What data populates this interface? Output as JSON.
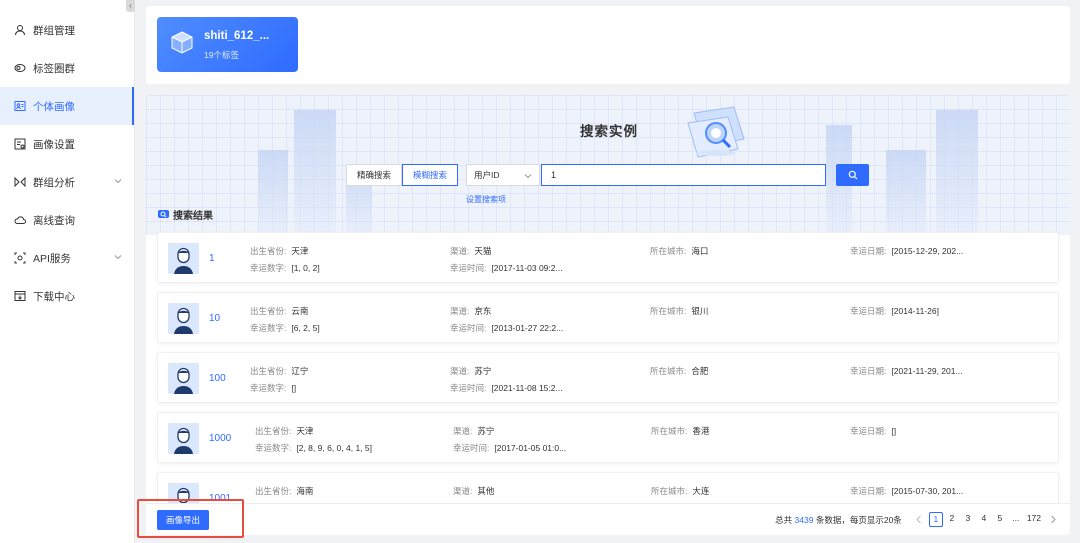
{
  "sidebar": {
    "collapse_glyph": "‹",
    "items": [
      {
        "label": "群组管理",
        "icon": "group-icon"
      },
      {
        "label": "标签圈群",
        "icon": "tag-circle-icon"
      },
      {
        "label": "个体画像",
        "icon": "profile-card-icon",
        "active": true
      },
      {
        "label": "画像设置",
        "icon": "profile-settings-icon"
      },
      {
        "label": "群组分析",
        "icon": "analysis-icon",
        "expandable": true
      },
      {
        "label": "离线查询",
        "icon": "cloud-query-icon"
      },
      {
        "label": "API服务",
        "icon": "api-icon",
        "expandable": true
      },
      {
        "label": "下载中心",
        "icon": "download-icon"
      }
    ]
  },
  "group_card": {
    "name": "shiti_612_...",
    "sub": "19个标签"
  },
  "hero": {
    "title": "搜索实例"
  },
  "search": {
    "modes": [
      "精确搜索",
      "模糊搜索"
    ],
    "active_mode": "模糊搜索",
    "field": "用户ID",
    "query": "1",
    "settings_link": "设置搜索项"
  },
  "results": {
    "title": "搜索结果",
    "labels": {
      "province": "出生省份:",
      "lucky_numbers": "幸运数字:",
      "channel": "渠道:",
      "lucky_time": "幸运时间:",
      "city": "所在城市:",
      "lucky_date": "幸运日期:"
    },
    "items": [
      {
        "id": "1",
        "province": "天津",
        "lucky_numbers": "[1, 0, 2]",
        "channel": "天猫",
        "lucky_time": "[2017-11-03 09:2...",
        "city": "海口",
        "lucky_date": "[2015-12-29, 202..."
      },
      {
        "id": "10",
        "province": "云南",
        "lucky_numbers": "[6, 2, 5]",
        "channel": "京东",
        "lucky_time": "[2013-01-27 22:2...",
        "city": "银川",
        "lucky_date": "[2014-11-26]"
      },
      {
        "id": "100",
        "province": "辽宁",
        "lucky_numbers": "[]",
        "channel": "苏宁",
        "lucky_time": "[2021-11-08 15:2...",
        "city": "合肥",
        "lucky_date": "[2021-11-29, 201..."
      },
      {
        "id": "1000",
        "province": "天津",
        "lucky_numbers": "[2, 8, 9, 6, 0, 4, 1, 5]",
        "channel": "苏宁",
        "lucky_time": "[2017-01-05 01:0...",
        "city": "香港",
        "lucky_date": "[]"
      },
      {
        "id": "1001",
        "province": "海南",
        "lucky_numbers": "",
        "channel": "其他",
        "lucky_time": "",
        "city": "大连",
        "lucky_date": "[2015-07-30, 201..."
      }
    ]
  },
  "footer": {
    "export_label": "画像导出",
    "total_prefix": "总共",
    "total_count": "3439",
    "total_suffix": "条数据，每页显示20条",
    "pages": [
      "1",
      "2",
      "3",
      "4",
      "5",
      "...",
      "172"
    ],
    "current_page": "1"
  },
  "colors": {
    "accent": "#2f6bff",
    "highlight": "#e74c3c"
  }
}
